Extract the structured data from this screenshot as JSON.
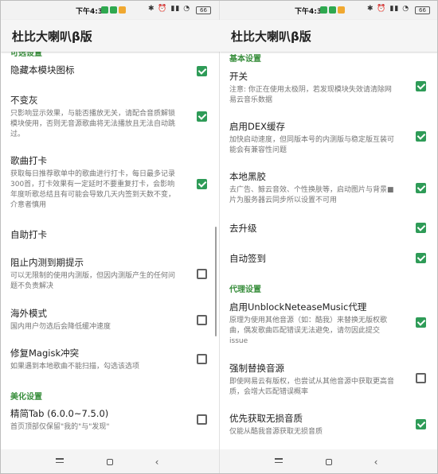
{
  "status_time": "下午4:33",
  "status_sys": "✱ ⏰ ▮▮ ◔",
  "battery": "66",
  "app_title": "杜比大喇叭β版",
  "left": {
    "section_top": "可选设置",
    "items": [
      {
        "title": "隐藏本模块图标",
        "checked": true
      },
      {
        "title": "不变灰",
        "summary": "只影响显示效果，与能否播放无关，请配合音质解锁模块使用，否则无音源歌曲将无法播放且无法自动跳过。",
        "checked": true
      },
      {
        "title": "歌曲打卡",
        "summary": "获取每日推荐歌单中的歌曲进行打卡，每日最多记录300首，打卡效果有一定延时不要重复打卡，会影响年度听歌总结且有可能会导致几天内签到天数不变，介意者慎用",
        "checked": true
      },
      {
        "title": "自助打卡"
      },
      {
        "title": "阻止内测到期提示",
        "summary": "可以无限制的使用内测版，但因内测版产生的任何问题不负责解决",
        "checked": false
      },
      {
        "title": "海外模式",
        "summary": "国内用户勿选后会降低缓冲速度",
        "checked": false
      },
      {
        "title": "修复Magisk冲突",
        "summary": "如果遇到本地歌曲不能扫描，勾选该选项",
        "checked": false
      }
    ],
    "section_beauty": "美化设置",
    "item_last": {
      "title": "精简Tab (6.0.0~7.5.0)",
      "summary": "首页顶部仅保留\"我的\"与\"发现\"",
      "checked": false
    }
  },
  "right": {
    "section_basic": "基本设置",
    "items": [
      {
        "title": "开关",
        "summary": "注意: 你正在使用太极阴，若发现模块失效请清除网易云音乐数据",
        "checked": true
      },
      {
        "title": "启用DEX缓存",
        "summary": "加快启动速度，但同版本号的内测版与稳定版互装可能会有兼容性问题",
        "checked": true
      },
      {
        "title": "本地黑胶",
        "summary": "去广告、鲸云音效、个性换肤等，启动图片与背景■片为服务器云同步所以设置不可用",
        "checked": true
      },
      {
        "title": "去升级",
        "checked": true
      },
      {
        "title": "自动签到",
        "checked": true
      }
    ],
    "section_proxy": "代理设置",
    "items2": [
      {
        "title": "启用UnblockNeteaseMusic代理",
        "summary": "原理为使用其他音源（如：酷我）来替换无版权歌曲，偶发歌曲匹配错误无法避免，请勿因此提交issue",
        "checked": true
      },
      {
        "title": "强制替换音源",
        "summary": "即使网易云有版权，也尝试从其他音源中获取更高音质，会增大匹配错误概率",
        "checked": false
      },
      {
        "title": "优先获取无损音质",
        "summary": "仅能从酷我音源获取无损音质",
        "checked": true
      }
    ]
  },
  "colors": {
    "accent": "#2e9b57",
    "section": "#388e3c"
  }
}
